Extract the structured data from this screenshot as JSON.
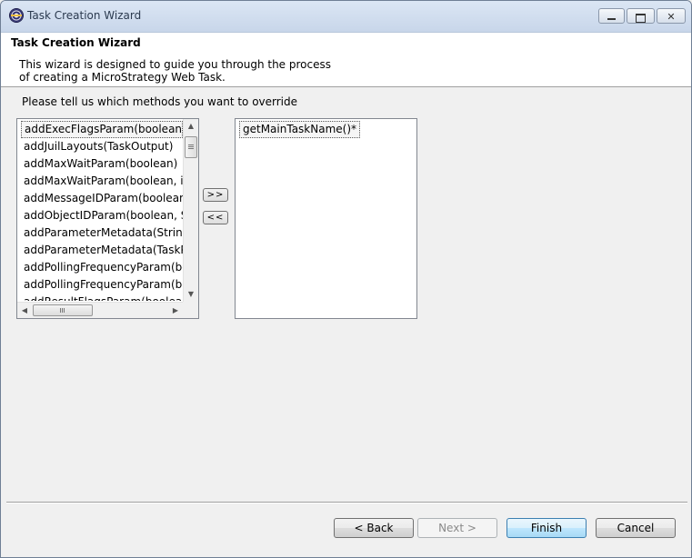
{
  "window": {
    "title": "Task Creation Wizard",
    "controls": {
      "minimize": "minimize",
      "maximize": "maximize",
      "close": "✕"
    }
  },
  "header": {
    "title": "Task Creation Wizard",
    "description_lines": [
      "This wizard is designed to guide you through the process",
      "of creating a MicroStrategy Web Task."
    ]
  },
  "body": {
    "prompt": "Please tell us which methods you want to override",
    "available_methods": [
      "addExecFlagsParam(boolean, String)",
      "addJuilLayouts(TaskOutput)",
      "addMaxWaitParam(boolean)",
      "addMaxWaitParam(boolean, int)",
      "addMessageIDParam(boolean, String)",
      "addObjectIDParam(boolean, String)",
      "addParameterMetadata(String, String)",
      "addParameterMetadata(TaskParameter)",
      "addPollingFrequencyParam(boolean)",
      "addPollingFrequencyParam(boolean, int)",
      "addResultFlagsParam(boolean, String)"
    ],
    "selected_methods": [
      "getMainTaskName()*"
    ],
    "add_button": ">>",
    "remove_button": "<<",
    "scroll_icons": {
      "up": "▲",
      "down": "▼",
      "left": "◀",
      "right": "▶"
    }
  },
  "footer": {
    "back": "< Back",
    "next": "Next >",
    "finish": "Finish",
    "cancel": "Cancel"
  },
  "colors": {
    "titlebar": "#c8d6ea",
    "finish_accent": "#3c7fb1"
  }
}
